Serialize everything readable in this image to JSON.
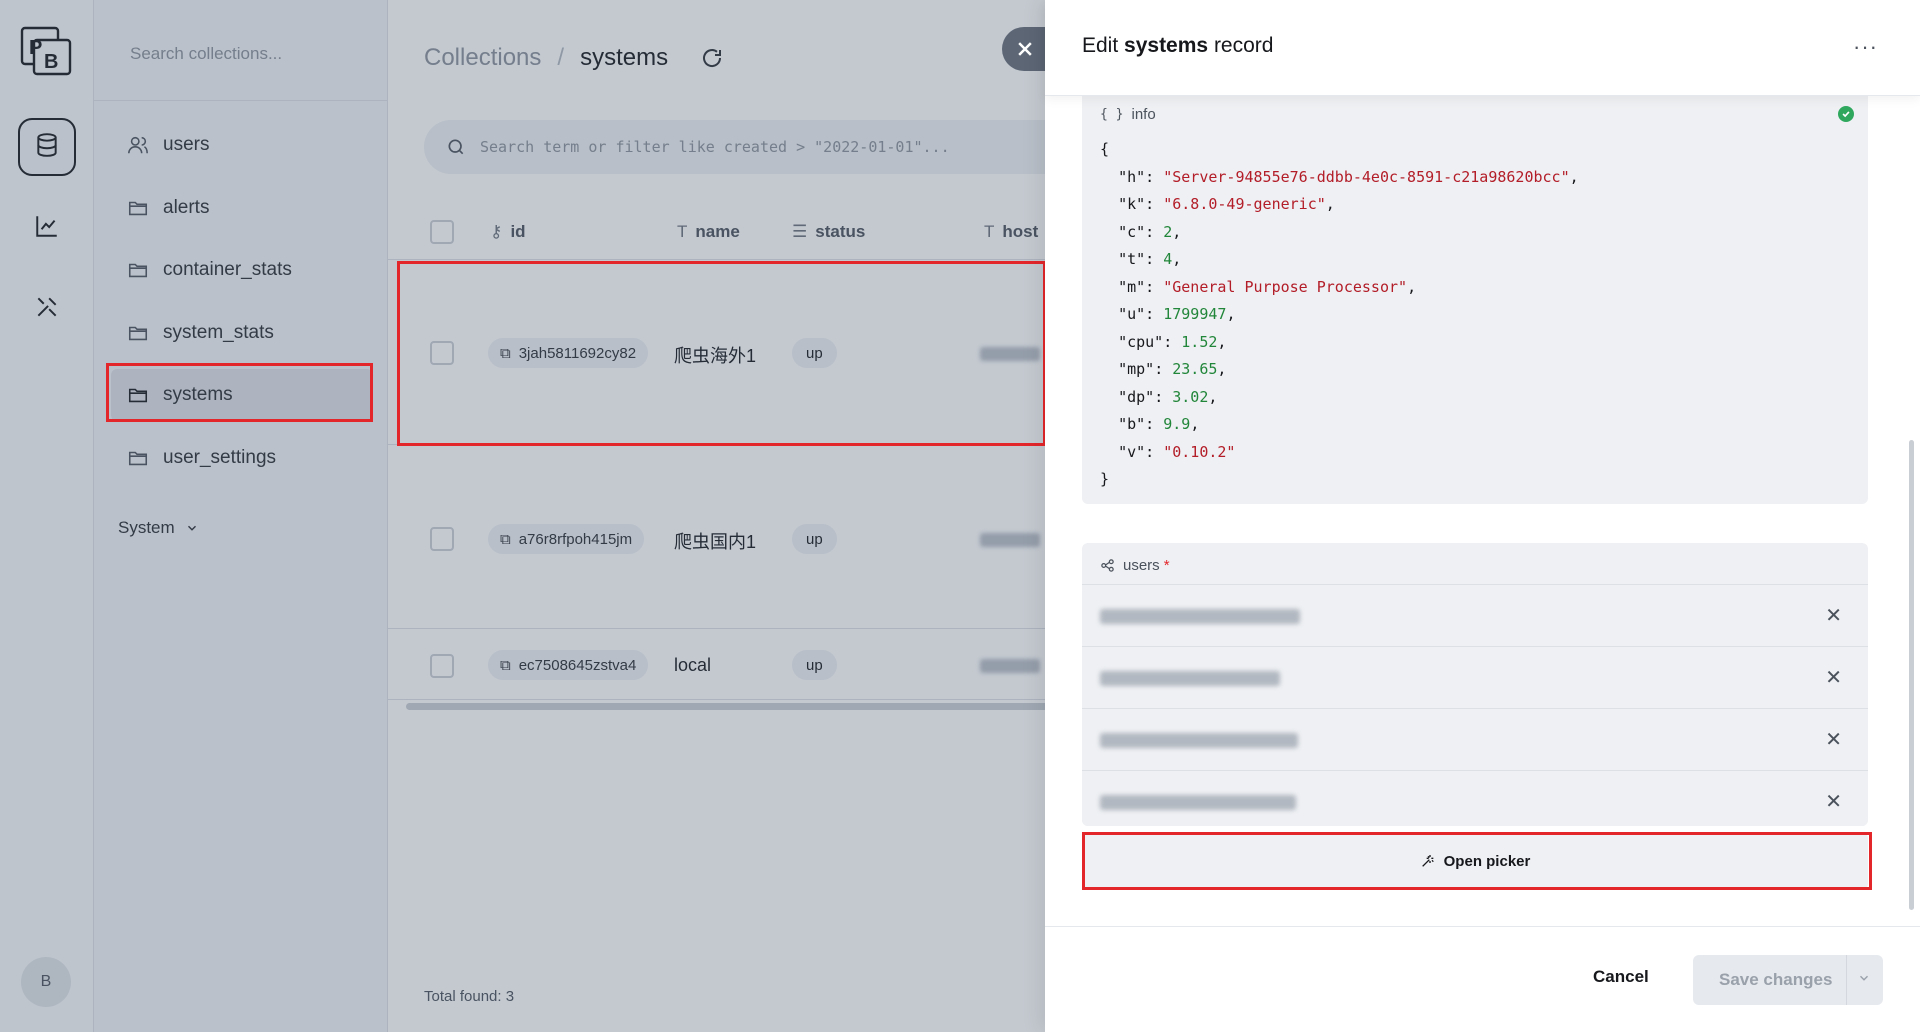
{
  "sidebar": {
    "search_placeholder": "Search collections...",
    "collections": [
      "users",
      "alerts",
      "container_stats",
      "system_stats",
      "systems",
      "user_settings"
    ],
    "active_index": 4,
    "system_label": "System"
  },
  "rail": {
    "avatar_letter": "B"
  },
  "breadcrumb": {
    "root": "Collections",
    "sep": "/",
    "current": "systems"
  },
  "records": {
    "search_placeholder": "Search term or filter like created > \"2022-01-01\"...",
    "columns": {
      "id": "id",
      "name": "name",
      "status": "status",
      "host": "host"
    },
    "rows": [
      {
        "id": "3jah5811692cy82",
        "name": "爬虫海外1",
        "status": "up"
      },
      {
        "id": "a76r8rfpoh415jm",
        "name": "爬虫国内1",
        "status": "up"
      },
      {
        "id": "ec7508645zstva4",
        "name": "local",
        "status": "up"
      }
    ],
    "total_label": "Total found:",
    "total_value": "3"
  },
  "panel": {
    "title_prefix": "Edit",
    "title_collection": "systems",
    "title_suffix": "record",
    "json_field_label": "info",
    "json_lines": [
      {
        "key": "\"h\"",
        "val": "\"Server-94855e76-ddbb-4e0c-8591-c21a98620bcc\"",
        "t": "s",
        "c": ","
      },
      {
        "key": "\"k\"",
        "val": "\"6.8.0-49-generic\"",
        "t": "s",
        "c": ","
      },
      {
        "key": "\"c\"",
        "val": "2",
        "t": "n",
        "c": ","
      },
      {
        "key": "\"t\"",
        "val": "4",
        "t": "n",
        "c": ","
      },
      {
        "key": "\"m\"",
        "val": "\"General Purpose Processor\"",
        "t": "s",
        "c": ","
      },
      {
        "key": "\"u\"",
        "val": "1799947",
        "t": "n",
        "c": ","
      },
      {
        "key": "\"cpu\"",
        "val": "1.52",
        "t": "n",
        "c": ","
      },
      {
        "key": "\"mp\"",
        "val": "23.65",
        "t": "n",
        "c": ","
      },
      {
        "key": "\"dp\"",
        "val": "3.02",
        "t": "n",
        "c": ","
      },
      {
        "key": "\"b\"",
        "val": "9.9",
        "t": "n",
        "c": ","
      },
      {
        "key": "\"v\"",
        "val": "\"0.10.2\"",
        "t": "s",
        "c": ""
      }
    ],
    "relation_label": "users",
    "relation_required_mark": "*",
    "open_picker_label": "Open picker",
    "cancel_label": "Cancel",
    "save_label": "Save changes",
    "more_label": "···"
  }
}
